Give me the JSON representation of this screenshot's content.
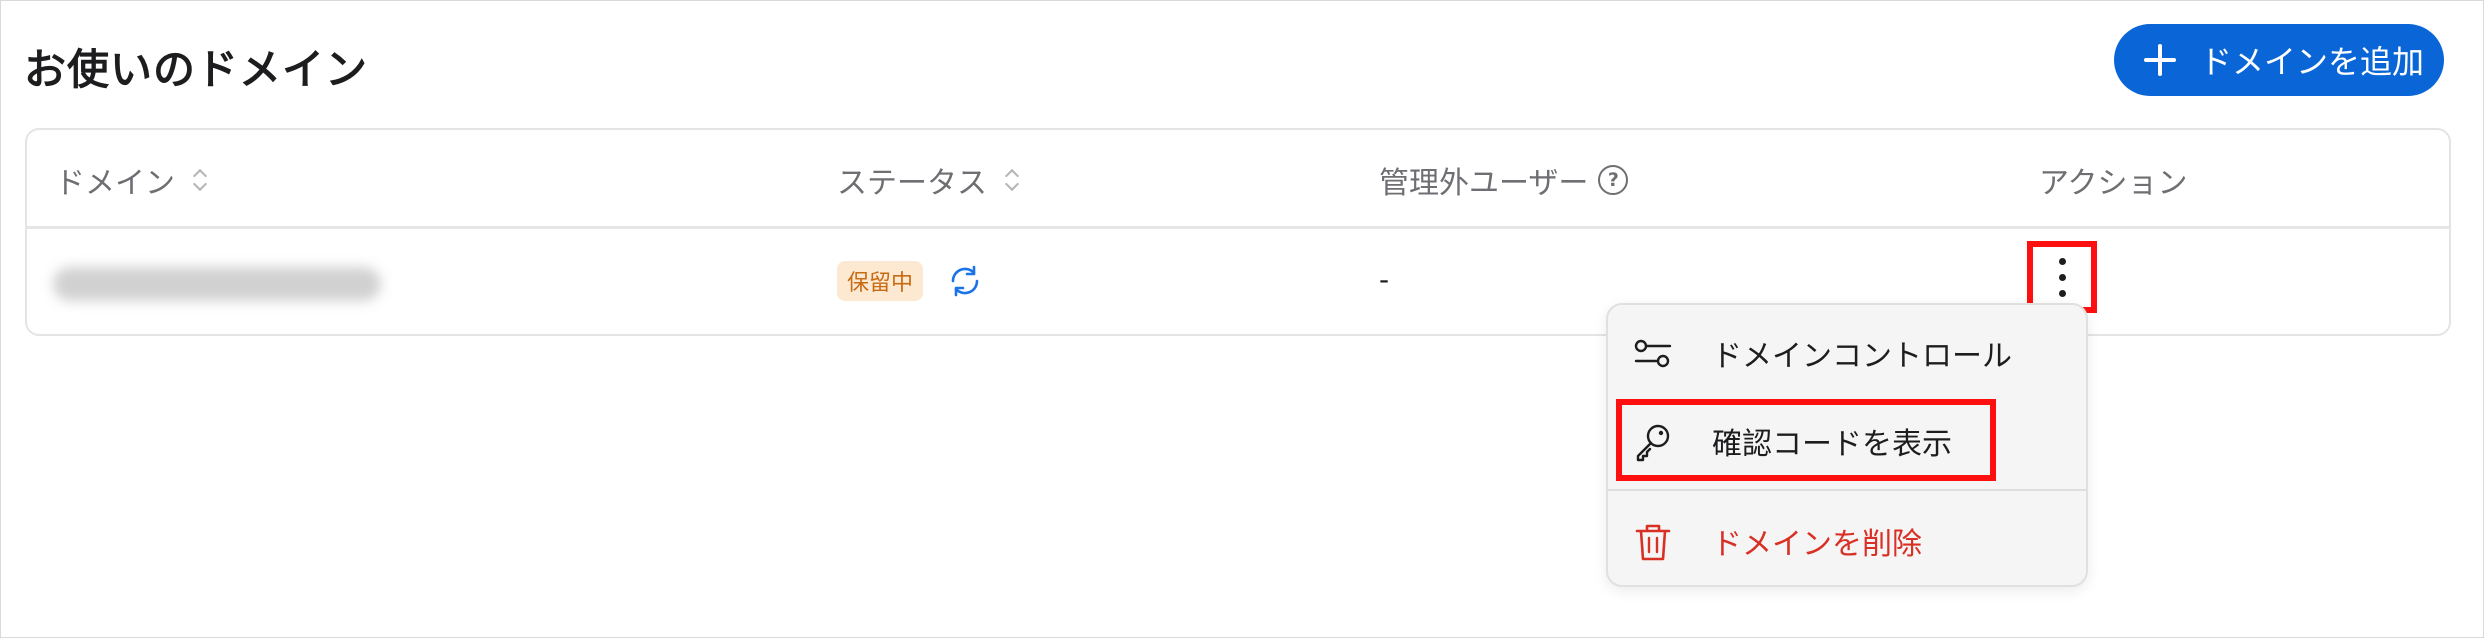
{
  "page": {
    "title": "お使いのドメイン"
  },
  "toolbar": {
    "add_domain_label": "ドメインを追加"
  },
  "table": {
    "columns": [
      {
        "label": "ドメイン",
        "sortable": true
      },
      {
        "label": "ステータス",
        "sortable": true
      },
      {
        "label": "管理外ユーザー",
        "help": true
      },
      {
        "label": "アクション"
      }
    ],
    "rows": [
      {
        "domain": "",
        "status": "保留中",
        "unmanaged_users": "-"
      }
    ]
  },
  "menu": {
    "items": [
      {
        "label": "ドメインコントロール",
        "icon": "sliders-icon"
      },
      {
        "label": "確認コードを表示",
        "icon": "key-icon"
      },
      {
        "label": "ドメインを削除",
        "icon": "trash-icon"
      }
    ]
  },
  "colors": {
    "accent": "#0a66d6",
    "danger": "#d93025",
    "pending_bg": "#fde9d2",
    "pending_text": "#c76b14",
    "highlight": "#ff1010"
  }
}
